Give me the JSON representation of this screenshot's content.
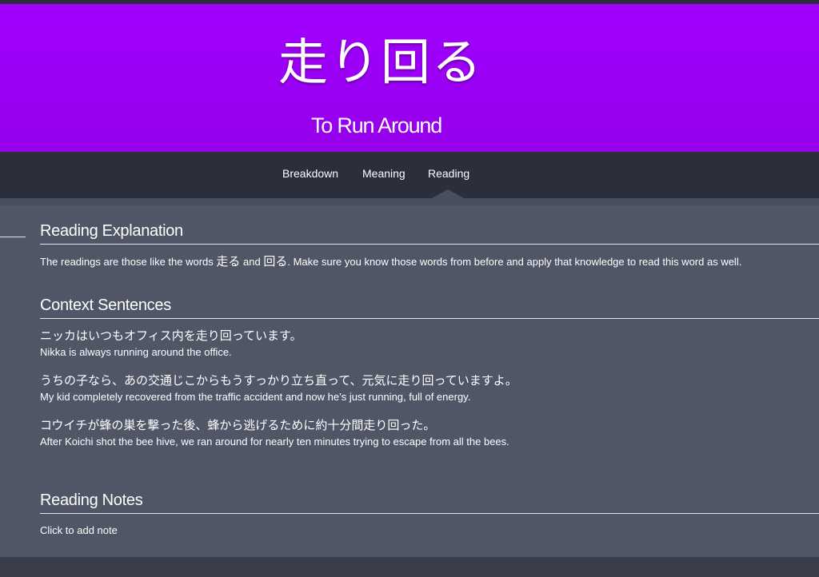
{
  "header": {
    "vocabulary": "走り回る",
    "meaning": "To Run Around",
    "background_color": "#a100ff"
  },
  "nav": {
    "items": [
      "Breakdown",
      "Meaning",
      "Reading"
    ],
    "active": "Reading"
  },
  "reading_explanation": {
    "title": "Reading Explanation",
    "text_1": "The readings are those like the words ",
    "word_1": "走る",
    "text_2": " and ",
    "word_2": "回る",
    "text_3": ". Make sure you know those words from before and apply that knowledge to read this word as well."
  },
  "context_sentences": {
    "title": "Context Sentences",
    "items": [
      {
        "ja": "ニッカはいつもオフィス内を走り回っています。",
        "en": "Nikka is always running around the office."
      },
      {
        "ja": "うちの子なら、あの交通じこからもうすっかり立ち直って、元気に走り回っていますよ。",
        "en": "My kid completely recovered from the traffic accident and now he’s just running, full of energy."
      },
      {
        "ja": "コウイチが蜂の巣を撃った後、蜂から逃げるために約十分間走り回った。",
        "en": "After Koichi shot the bee hive, we ran around for nearly ten minutes trying to escape from all the bees."
      }
    ]
  },
  "reading_notes": {
    "title": "Reading Notes",
    "placeholder": "Click to add note"
  }
}
